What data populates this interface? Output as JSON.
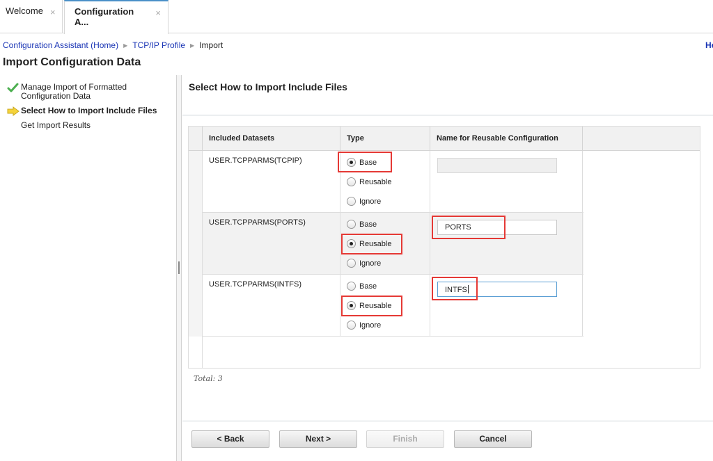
{
  "tabs": [
    {
      "label": "Welcome",
      "close_icon": "close-icon",
      "active": false
    },
    {
      "label": "Configuration A...",
      "close_icon": "close-icon",
      "active": true
    }
  ],
  "close_glyph": "×",
  "breadcrumb": {
    "items": [
      "Configuration Assistant (Home)",
      "TCP/IP Profile"
    ],
    "current": "Import",
    "separator_icon": "triangle-right-icon"
  },
  "help_link": "He",
  "page_title": "Import Configuration Data",
  "steps": [
    {
      "label": "Manage Import of Formatted Configuration Data",
      "status": "complete",
      "icon": "checkmark-icon"
    },
    {
      "label": "Select How to Import Include Files",
      "status": "current",
      "icon": "arrow-right-icon"
    },
    {
      "label": "Get Import Results",
      "status": "pending",
      "icon": ""
    }
  ],
  "panel_title": "Select How to Import Include Files",
  "table": {
    "columns": [
      "Included Datasets",
      "Type",
      "Name for Reusable Configuration"
    ],
    "type_options": [
      "Base",
      "Reusable",
      "Ignore"
    ],
    "rows": [
      {
        "dataset": "USER.TCPPARMS(TCPIP)",
        "type": "Base",
        "name": "",
        "name_disabled": true
      },
      {
        "dataset": "USER.TCPPARMS(PORTS)",
        "type": "Reusable",
        "name": "PORTS",
        "name_disabled": false
      },
      {
        "dataset": "USER.TCPPARMS(INTFS)",
        "type": "Reusable",
        "name": "INTFS",
        "name_disabled": false,
        "focused": true
      }
    ]
  },
  "total_label": "Total: 3",
  "buttons": {
    "back": "< Back",
    "next": "Next >",
    "finish": "Finish",
    "cancel": "Cancel",
    "finish_disabled": true
  },
  "highlight_color": "#e53935",
  "link_color": "#1a35b5"
}
